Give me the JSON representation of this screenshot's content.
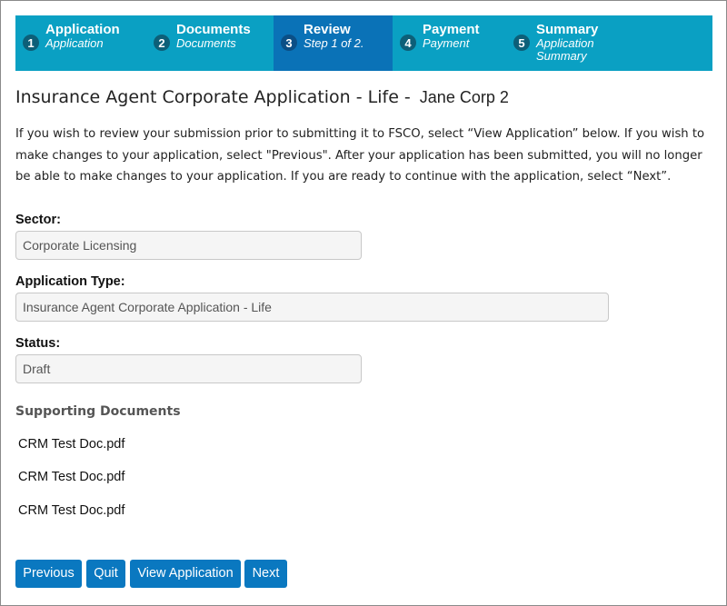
{
  "wizard": {
    "steps": [
      {
        "number": "1",
        "title": "Application",
        "subtitle": "Application"
      },
      {
        "number": "2",
        "title": "Documents",
        "subtitle": "Documents"
      },
      {
        "number": "3",
        "title": "Review",
        "subtitle": "Step 1 of 2.",
        "active": true
      },
      {
        "number": "4",
        "title": "Payment",
        "subtitle": "Payment"
      },
      {
        "number": "5",
        "title": "Summary",
        "subtitle": "Application Summary"
      }
    ]
  },
  "page": {
    "title": "Insurance Agent Corporate Application - Life -",
    "applicant": "Jane Corp 2",
    "intro": "If you wish to review your submission prior to submitting it to FSCO, select “View Application” below. If you wish to make changes to your application, select \"Previous\". After your application has been submitted, you will no longer be able to make changes to your application. If you are ready to continue with the application, select “Next”."
  },
  "form": {
    "sector_label": "Sector:",
    "sector_value": "Corporate Licensing",
    "type_label": "Application Type:",
    "type_value": "Insurance Agent Corporate Application - Life",
    "status_label": "Status:",
    "status_value": "Draft"
  },
  "documents": {
    "heading": "Supporting Documents",
    "items": [
      "CRM Test Doc.pdf",
      "CRM Test Doc.pdf",
      "CRM Test Doc.pdf"
    ]
  },
  "buttons": {
    "previous": "Previous",
    "quit": "Quit",
    "view": "View Application",
    "next": "Next"
  },
  "colors": {
    "wizard_bg": "#0aa0c3",
    "wizard_active": "#0a72b7",
    "button_bg": "#0a78c0"
  }
}
